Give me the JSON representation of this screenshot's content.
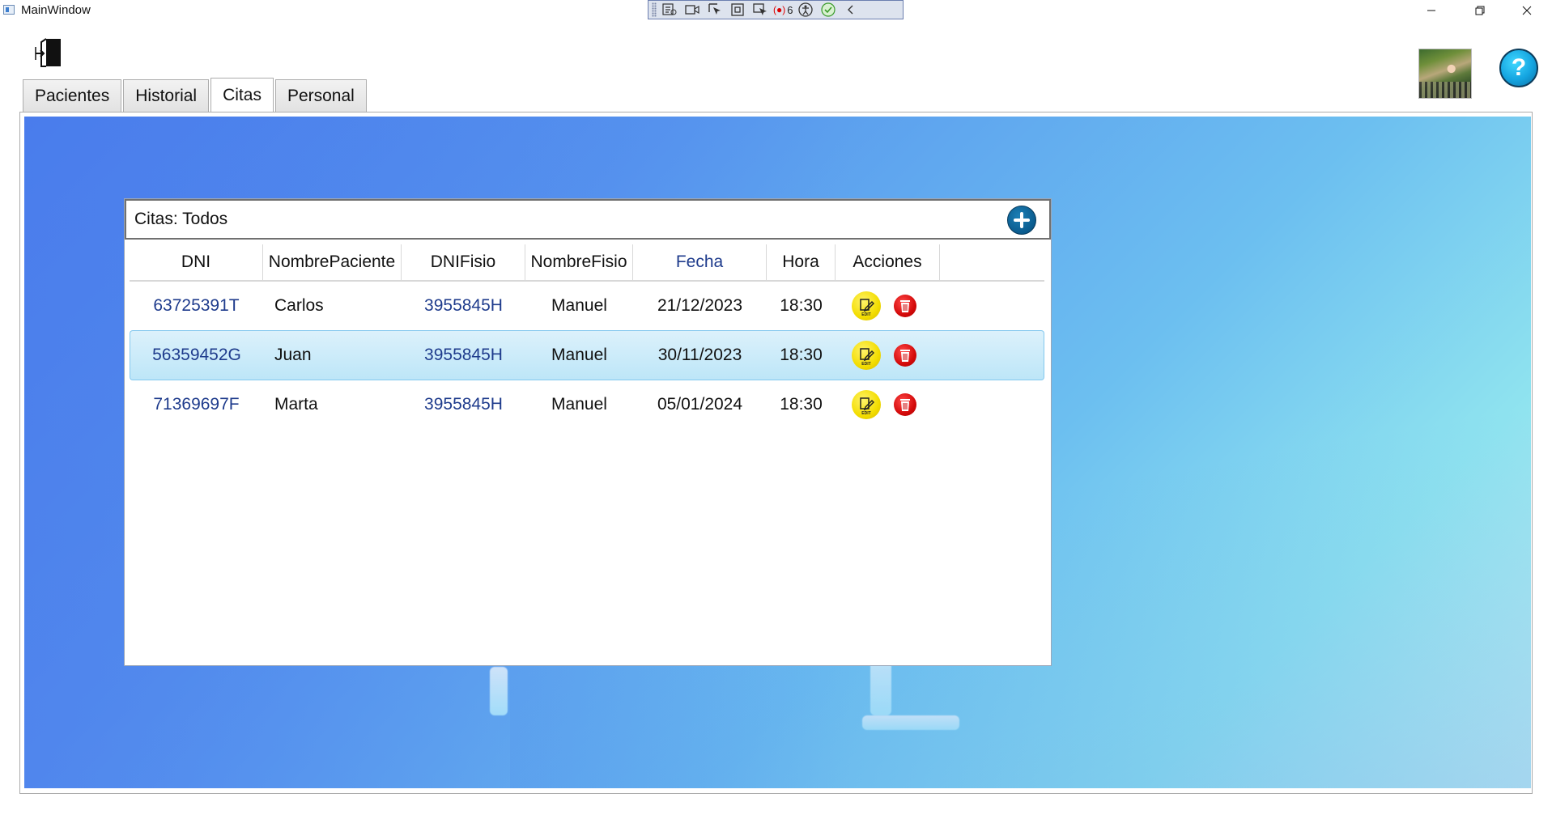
{
  "window": {
    "title": "MainWindow"
  },
  "debug_toolbar": {
    "binding_errors": "6"
  },
  "tabs": [
    {
      "label": "Pacientes",
      "active": false
    },
    {
      "label": "Historial",
      "active": false
    },
    {
      "label": "Citas",
      "active": true
    },
    {
      "label": "Personal",
      "active": false
    }
  ],
  "panel": {
    "title": "Citas: Todos",
    "columns": [
      "DNI",
      "NombrePaciente",
      "DNIFisio",
      "NombreFisio",
      "Fecha",
      "Hora",
      "Acciones"
    ],
    "rows": [
      {
        "dni": "63725391T",
        "nombre_paciente": "Carlos",
        "dni_fisio": "3955845H",
        "nombre_fisio": "Manuel",
        "fecha": "21/12/2023",
        "hora": "18:30",
        "selected": false
      },
      {
        "dni": "56359452G",
        "nombre_paciente": "Juan",
        "dni_fisio": "3955845H",
        "nombre_fisio": "Manuel",
        "fecha": "30/11/2023",
        "hora": "18:30",
        "selected": true
      },
      {
        "dni": "71369697F",
        "nombre_paciente": "Marta",
        "dni_fisio": "3955845H",
        "nombre_fisio": "Manuel",
        "fecha": "05/01/2024",
        "hora": "18:30",
        "selected": false
      }
    ],
    "edit_label": "EDIT"
  },
  "help": {
    "label": "?"
  },
  "colors": {
    "accent_blue": "#1e3b8c",
    "edit_yellow": "#f3dd00",
    "delete_red": "#d40a0a",
    "add_blue": "#0a5b8e"
  },
  "icons": [
    "app-icon",
    "exit-door-icon",
    "help-icon",
    "add-icon",
    "edit-icon",
    "delete-icon",
    "minimize-icon",
    "maximize-icon",
    "close-icon"
  ]
}
